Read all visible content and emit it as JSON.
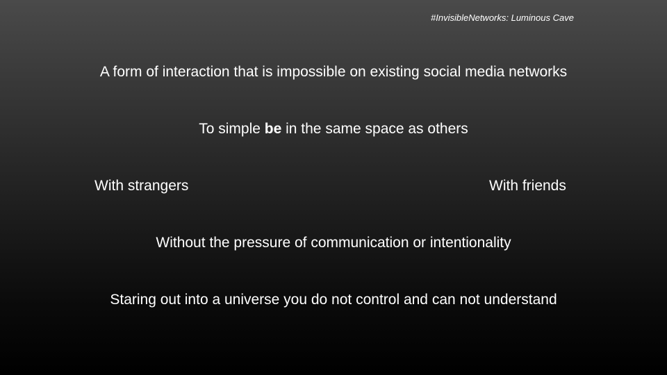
{
  "slide": {
    "tag": "#InvisibleNetworks: Luminous Cave",
    "line1": "A form of interaction that is impossible on existing social media networks",
    "line2": {
      "before": "To simple ",
      "emphasis": "be",
      "after": " in the same space as others"
    },
    "left_phrase": "With strangers",
    "right_phrase": "With friends",
    "line4": "Without the pressure of communication or intentionality",
    "line5": "Staring out into a universe you do not control and can not understand"
  }
}
